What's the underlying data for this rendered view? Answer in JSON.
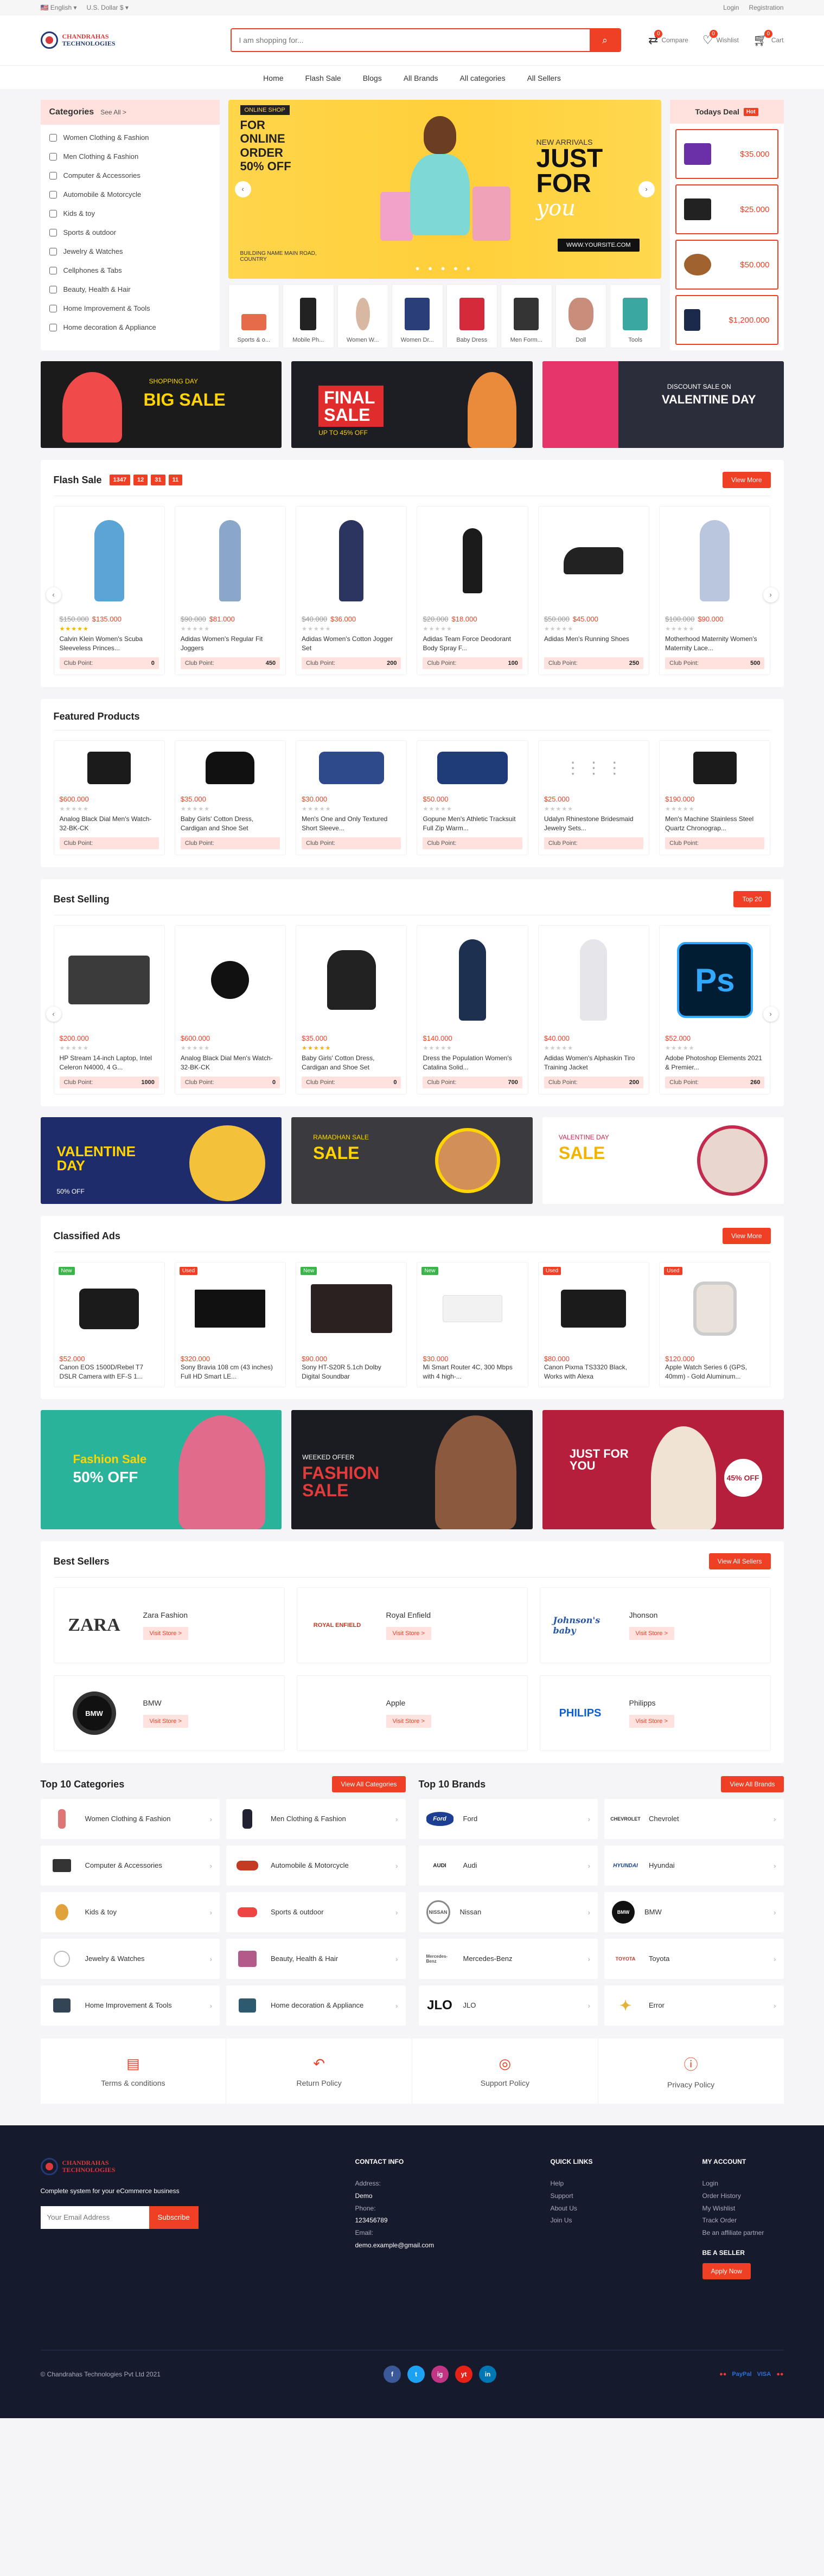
{
  "topbar": {
    "language": "English",
    "currency": "U.S. Dollar $",
    "login": "Login",
    "register": "Registration"
  },
  "logo": {
    "line1": "CHANDRAHAS",
    "line2": "TECHNOLOGIES"
  },
  "search": {
    "placeholder": "I am shopping for..."
  },
  "header_icons": [
    {
      "label": "Compare",
      "count": "0"
    },
    {
      "label": "Wishlist",
      "count": "0"
    },
    {
      "label": "Cart",
      "count": "0"
    }
  ],
  "nav": [
    "Home",
    "Flash Sale",
    "Blogs",
    "All Brands",
    "All categories",
    "All Sellers"
  ],
  "categories": {
    "title": "Categories",
    "see_all": "See All >",
    "items": [
      "Women Clothing & Fashion",
      "Men Clothing & Fashion",
      "Computer & Accessories",
      "Automobile & Motorcycle",
      "Kids & toy",
      "Sports & outdoor",
      "Jewelry & Watches",
      "Cellphones & Tabs",
      "Beauty, Health & Hair",
      "Home Improvement & Tools",
      "Home decoration & Appliance"
    ]
  },
  "slider": {
    "tag": "ONLINE SHOP",
    "left": "FOR ONLINE ORDER 50% OFF",
    "new_arrivals": "NEW ARRIVALS",
    "big": "JUST FOR",
    "script": "you",
    "website": "WWW.YOURSITE.COM",
    "address": "BUILDING NAME MAIN ROAD, COUNTRY"
  },
  "thumbs": [
    "Sports & o...",
    "Mobile Ph...",
    "Women W...",
    "Women Dr...",
    "Baby Dress",
    "Men Form...",
    "Doll",
    "Tools"
  ],
  "deal": {
    "title": "Todays Deal",
    "hot": "Hot",
    "prices": [
      "$35.000",
      "$25.000",
      "$50.000",
      "$1,200.000"
    ]
  },
  "promo1": [
    {
      "t1": "BIG SALE",
      "t2": "SHOPPING DAY"
    },
    {
      "t1": "FINAL SALE",
      "t2": "UP TO 45% OFF"
    },
    {
      "t1": "VALENTINE DAY",
      "t2": "DISCOUNT SALE ON"
    }
  ],
  "flash": {
    "title": "Flash Sale",
    "timer": [
      "1347",
      "12",
      "31",
      "11"
    ],
    "btn": "View More",
    "items": [
      {
        "old": "$150.000",
        "price": "$135.000",
        "name": "Calvin Klein Women's Scuba Sleeveless Princes...",
        "points": "0"
      },
      {
        "old": "$90.000",
        "price": "$81.000",
        "name": "Adidas Women's Regular Fit Joggers",
        "points": "450"
      },
      {
        "old": "$40.000",
        "price": "$36.000",
        "name": "Adidas Women's Cotton Jogger Set",
        "points": "200"
      },
      {
        "old": "$20.000",
        "price": "$18.000",
        "name": "Adidas Team Force Deodorant Body Spray F...",
        "points": "100"
      },
      {
        "old": "$50.000",
        "price": "$45.000",
        "name": "Adidas Men's Running Shoes",
        "points": "250"
      },
      {
        "old": "$100.000",
        "price": "$90.000",
        "name": "Motherhood Maternity Women's Maternity Lace...",
        "points": "500"
      }
    ]
  },
  "featured": {
    "title": "Featured Products",
    "items": [
      {
        "price": "$600.000",
        "name": "Analog Black Dial Men's Watch-32-BK-CK"
      },
      {
        "price": "$35.000",
        "name": "Baby Girls' Cotton Dress, Cardigan and Shoe Set"
      },
      {
        "price": "$30.000",
        "name": "Men's One and Only Textured Short Sleeve..."
      },
      {
        "price": "$50.000",
        "name": "Gopune Men's Athletic Tracksuit Full Zip Warm..."
      },
      {
        "price": "$25.000",
        "name": "Udalyn Rhinestone Bridesmaid Jewelry Sets..."
      },
      {
        "price": "$190.000",
        "name": "Men's Machine Stainless Steel Quartz Chronograp..."
      }
    ],
    "club": "Club Point:"
  },
  "best": {
    "title": "Best Selling",
    "btn": "Top 20",
    "items": [
      {
        "price": "$200.000",
        "name": "HP Stream 14-inch Laptop, Intel Celeron N4000, 4 G...",
        "points": "1000"
      },
      {
        "price": "$600.000",
        "name": "Analog Black Dial Men's Watch-32-BK-CK",
        "points": "0"
      },
      {
        "price": "$35.000",
        "name": "Baby Girls' Cotton Dress, Cardigan and Shoe Set",
        "points": "0"
      },
      {
        "price": "$140.000",
        "name": "Dress the Population Women's Catalina Solid...",
        "points": "700"
      },
      {
        "price": "$40.000",
        "name": "Adidas Women's Alphaskin Tiro Training Jacket",
        "points": "200"
      },
      {
        "price": "$52.000",
        "name": "Adobe Photoshop Elements 2021 & Premier...",
        "points": "260"
      }
    ]
  },
  "promo2": [
    {
      "t1": "VALENTINE DAY",
      "t2": "50% OFF"
    },
    {
      "t1": "SALE",
      "t2": "RAMADHAN SALE"
    },
    {
      "t1": "SALE",
      "t2": "VALENTINE DAY"
    }
  ],
  "classified": {
    "title": "Classified Ads",
    "btn": "View More",
    "items": [
      {
        "tag": "New",
        "price": "$52.000",
        "name": "Canon EOS 1500D/Rebel T7 DSLR Camera with EF-S 1..."
      },
      {
        "tag": "Used",
        "price": "$320.000",
        "name": "Sony Bravia 108 cm (43 inches) Full HD Smart LE..."
      },
      {
        "tag": "New",
        "price": "$90.000",
        "name": "Sony HT-S20R 5.1ch Dolby Digital Soundbar"
      },
      {
        "tag": "New",
        "price": "$30.000",
        "name": "Mi Smart Router 4C, 300 Mbps with 4 high-..."
      },
      {
        "tag": "Used",
        "price": "$80.000",
        "name": "Canon Pixma TS3320 Black, Works with Alexa"
      },
      {
        "tag": "Used",
        "price": "$120.000",
        "name": "Apple Watch Series 6 (GPS, 40mm) - Gold Aluminum..."
      }
    ]
  },
  "promo3": [
    {
      "t1": "Fashion Sale",
      "t2": "50% OFF"
    },
    {
      "t1": "FASHION SALE",
      "t2": "WEEKED OFFER"
    },
    {
      "t1": "JUST FOR YOU",
      "t2": "45% OFF"
    }
  ],
  "sellers": {
    "title": "Best Sellers",
    "btn": "View All Sellers",
    "visit": "Visit Store >",
    "items": [
      {
        "logo": "ZARA",
        "name": "Zara Fashion"
      },
      {
        "logo": "ROYAL ENFIELD",
        "name": "Royal Enfield"
      },
      {
        "logo": "Johnson's baby",
        "name": "Jhonson"
      },
      {
        "logo": "BMW",
        "name": "BMW"
      },
      {
        "logo": "",
        "name": "Apple"
      },
      {
        "logo": "PHILIPS",
        "name": "Philipps"
      }
    ]
  },
  "topcats": {
    "title": "Top 10 Categories",
    "btn": "View All Categories",
    "items": [
      "Women Clothing & Fashion",
      "Men Clothing & Fashion",
      "Computer & Accessories",
      "Automobile & Motorcycle",
      "Kids & toy",
      "Sports & outdoor",
      "Jewelry & Watches",
      "Beauty, Health & Hair",
      "Home Improvement & Tools",
      "Home decoration & Appliance"
    ]
  },
  "topbrands": {
    "title": "Top 10 Brands",
    "btn": "View All Brands",
    "items": [
      {
        "logo": "Ford",
        "name": "Ford"
      },
      {
        "logo": "CHEVROLET",
        "name": "Chevrolet"
      },
      {
        "logo": "AUDI",
        "name": "Audi"
      },
      {
        "logo": "HYUNDAI",
        "name": "Hyundai"
      },
      {
        "logo": "NISSAN",
        "name": "Nissan"
      },
      {
        "logo": "BMW",
        "name": "BMW"
      },
      {
        "logo": "Mercedes-Benz",
        "name": "Mercedes-Benz"
      },
      {
        "logo": "TOYOTA",
        "name": "Toyota"
      },
      {
        "logo": "JLO",
        "name": "JLO"
      },
      {
        "logo": "",
        "name": "Error"
      }
    ]
  },
  "policies": [
    "Terms & conditions",
    "Return Policy",
    "Support Policy",
    "Privacy Policy"
  ],
  "footer": {
    "tagline": "Complete system for your eCommerce business",
    "email_placeholder": "Your Email Address",
    "subscribe": "Subscribe",
    "contact_title": "CONTACT INFO",
    "address_label": "Address:",
    "address": "Demo",
    "phone_label": "Phone:",
    "phone": "123456789",
    "email_label": "Email:",
    "email": "demo.example@gmail.com",
    "quick_title": "QUICK LINKS",
    "quick": [
      "Help",
      "Support",
      "About Us",
      "Join Us"
    ],
    "account_title": "MY ACCOUNT",
    "account": [
      "Login",
      "Order History",
      "My Wishlist",
      "Track Order",
      "Be an affiliate partner"
    ],
    "seller_title": "BE A SELLER",
    "apply": "Apply Now",
    "copyright": "© Chandrahas Technologies Pvt Ltd 2021",
    "social": [
      "f",
      "t",
      "ig",
      "yt",
      "in"
    ],
    "payments": [
      "PayPal",
      "VISA"
    ]
  },
  "colors": {
    "accent": "#ef3f24",
    "footer_bg": "#151a2d",
    "pale": "#ffe2de"
  }
}
